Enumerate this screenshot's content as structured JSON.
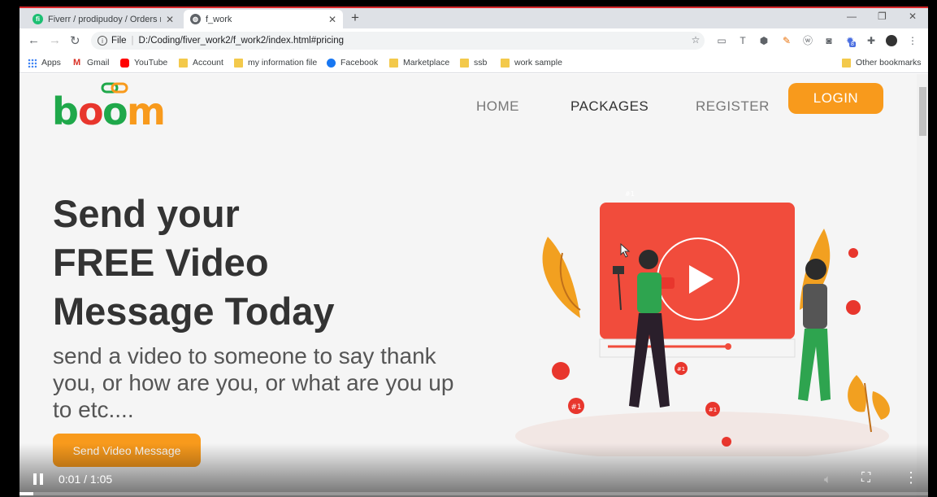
{
  "browser": {
    "tabs": [
      {
        "title": "Fiverr / prodipudoy / Orders mac",
        "close": "✕"
      },
      {
        "title": "f_work",
        "close": "✕"
      }
    ],
    "new_tab": "+",
    "url_prefix": "File",
    "url": "D:/Coding/fiver_work2/f_work2/index.html#pricing",
    "ext_badge": "8"
  },
  "bookmarks": {
    "items": [
      "Apps",
      "Gmail",
      "YouTube",
      "Account",
      "my information file",
      "Facebook",
      "Marketplace",
      "ssb",
      "work sample"
    ],
    "other": "Other bookmarks"
  },
  "site": {
    "logo": "boom",
    "nav": {
      "home": "HOME",
      "packages": "PACKAGES",
      "register": "REGISTER",
      "login": "LOGIN"
    },
    "hero": {
      "title_lines": [
        "Send your",
        "FREE Video",
        "Message Today"
      ],
      "text": "send a video to someone to say thank you, or how are you, or what are you up to etc....",
      "cta": "Send Video Message"
    },
    "badges": [
      "#1",
      "#1",
      "#1",
      "#1"
    ],
    "colors": {
      "accent": "#f89a1c",
      "video": "#f14c3c",
      "logo_green": "#1fa84a",
      "logo_red": "#e8362d",
      "logo_orange": "#f89a1c"
    }
  },
  "player": {
    "time": "0:01 / 1:05",
    "progress": 0.015
  }
}
